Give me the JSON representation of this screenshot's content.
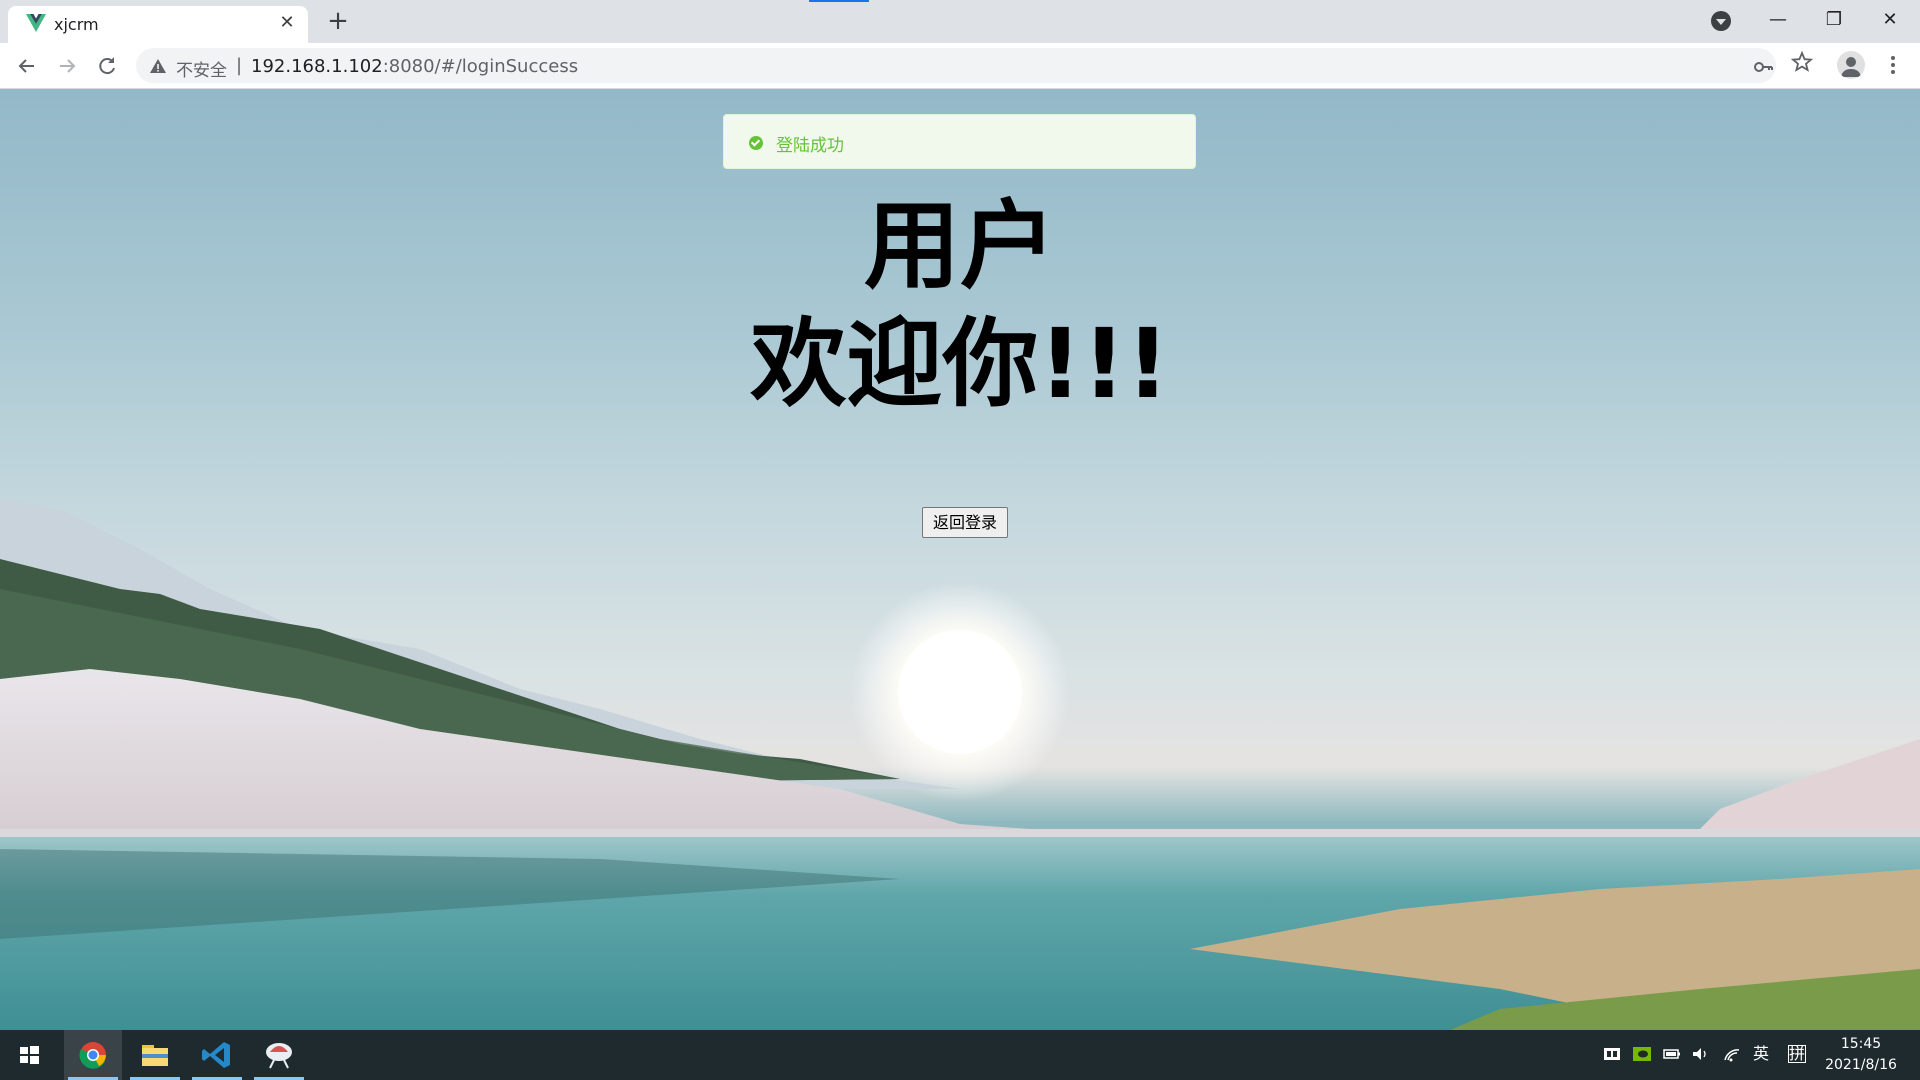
{
  "browser": {
    "tab_title": "xjcrm",
    "tab_close": "✕",
    "new_tab": "+",
    "window_controls": {
      "minimize": "—",
      "restore": "❐",
      "close": "✕"
    },
    "security_label": "不安全",
    "separator": "|",
    "url_host": "192.168.1.102",
    "url_path": ":8080/#/loginSuccess",
    "icons": [
      "back-icon",
      "forward-icon",
      "reload-icon",
      "warning-icon",
      "key-icon",
      "star-icon",
      "account-icon",
      "menu-icon"
    ]
  },
  "page": {
    "toast_message": "登陆成功",
    "heading_line1": "用户",
    "heading_line2": "欢迎你!!!",
    "back_button": "返回登录"
  },
  "taskbar": {
    "apps": [
      "start-icon",
      "chrome-icon",
      "file-explorer-icon",
      "vscode-icon",
      "app-icon"
    ],
    "tray": {
      "ime_lang": "英",
      "ime_mode": "拼"
    },
    "time": "15:45",
    "date": "2021/8/16"
  },
  "colors": {
    "toast_bg": "#f0f9eb",
    "toast_text": "#67c23a",
    "taskbar": "#1f2a2f",
    "accent": "#1a73e8"
  }
}
